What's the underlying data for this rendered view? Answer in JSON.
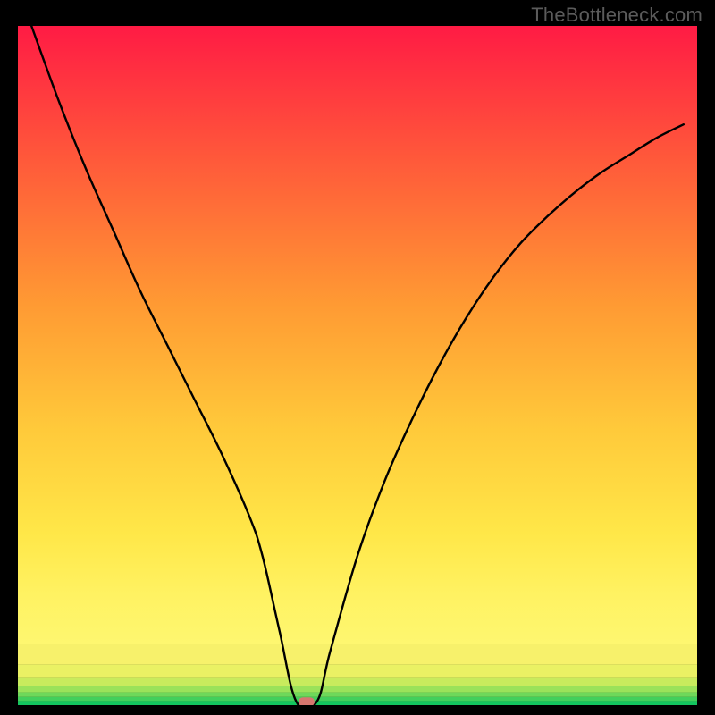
{
  "watermark": "TheBottleneck.com",
  "chart_data": {
    "type": "line",
    "title": "",
    "xlabel": "",
    "ylabel": "",
    "xlim": [
      0,
      100
    ],
    "ylim": [
      0,
      100
    ],
    "series": [
      {
        "name": "curve",
        "x": [
          2,
          6,
          10,
          14,
          18,
          22,
          26,
          30,
          34,
          36,
          38.5,
          41,
          44,
          46,
          50,
          54,
          58,
          62,
          66,
          70,
          74,
          78,
          82,
          86,
          90,
          94,
          98
        ],
        "y": [
          100,
          89,
          79,
          70,
          61,
          53,
          45,
          37,
          28,
          22,
          11,
          0.5,
          0.5,
          8,
          22,
          33,
          42,
          50,
          57,
          63,
          68,
          72,
          75.5,
          78.5,
          81,
          83.5,
          85.5
        ]
      }
    ],
    "marker": {
      "x": 42.5,
      "y": 0.5
    },
    "bands": [
      {
        "from": 0.0,
        "to": 0.6,
        "color": "#13c55f"
      },
      {
        "from": 0.6,
        "to": 1.2,
        "color": "#42cf5c"
      },
      {
        "from": 1.2,
        "to": 1.9,
        "color": "#6ed85a"
      },
      {
        "from": 1.9,
        "to": 2.8,
        "color": "#9ae25a"
      },
      {
        "from": 2.8,
        "to": 4.0,
        "color": "#c8eb5d"
      },
      {
        "from": 4.0,
        "to": 6.0,
        "color": "#eaf164"
      },
      {
        "from": 6.0,
        "to": 9.0,
        "color": "#f7f16b"
      }
    ],
    "gradient_stops": [
      {
        "offset": 0,
        "color": "#ff1b44"
      },
      {
        "offset": 22,
        "color": "#ff5a3a"
      },
      {
        "offset": 45,
        "color": "#ff9a33"
      },
      {
        "offset": 65,
        "color": "#ffc93a"
      },
      {
        "offset": 82,
        "color": "#ffe748"
      },
      {
        "offset": 92,
        "color": "#fff262"
      },
      {
        "offset": 100,
        "color": "#fef770"
      }
    ]
  }
}
